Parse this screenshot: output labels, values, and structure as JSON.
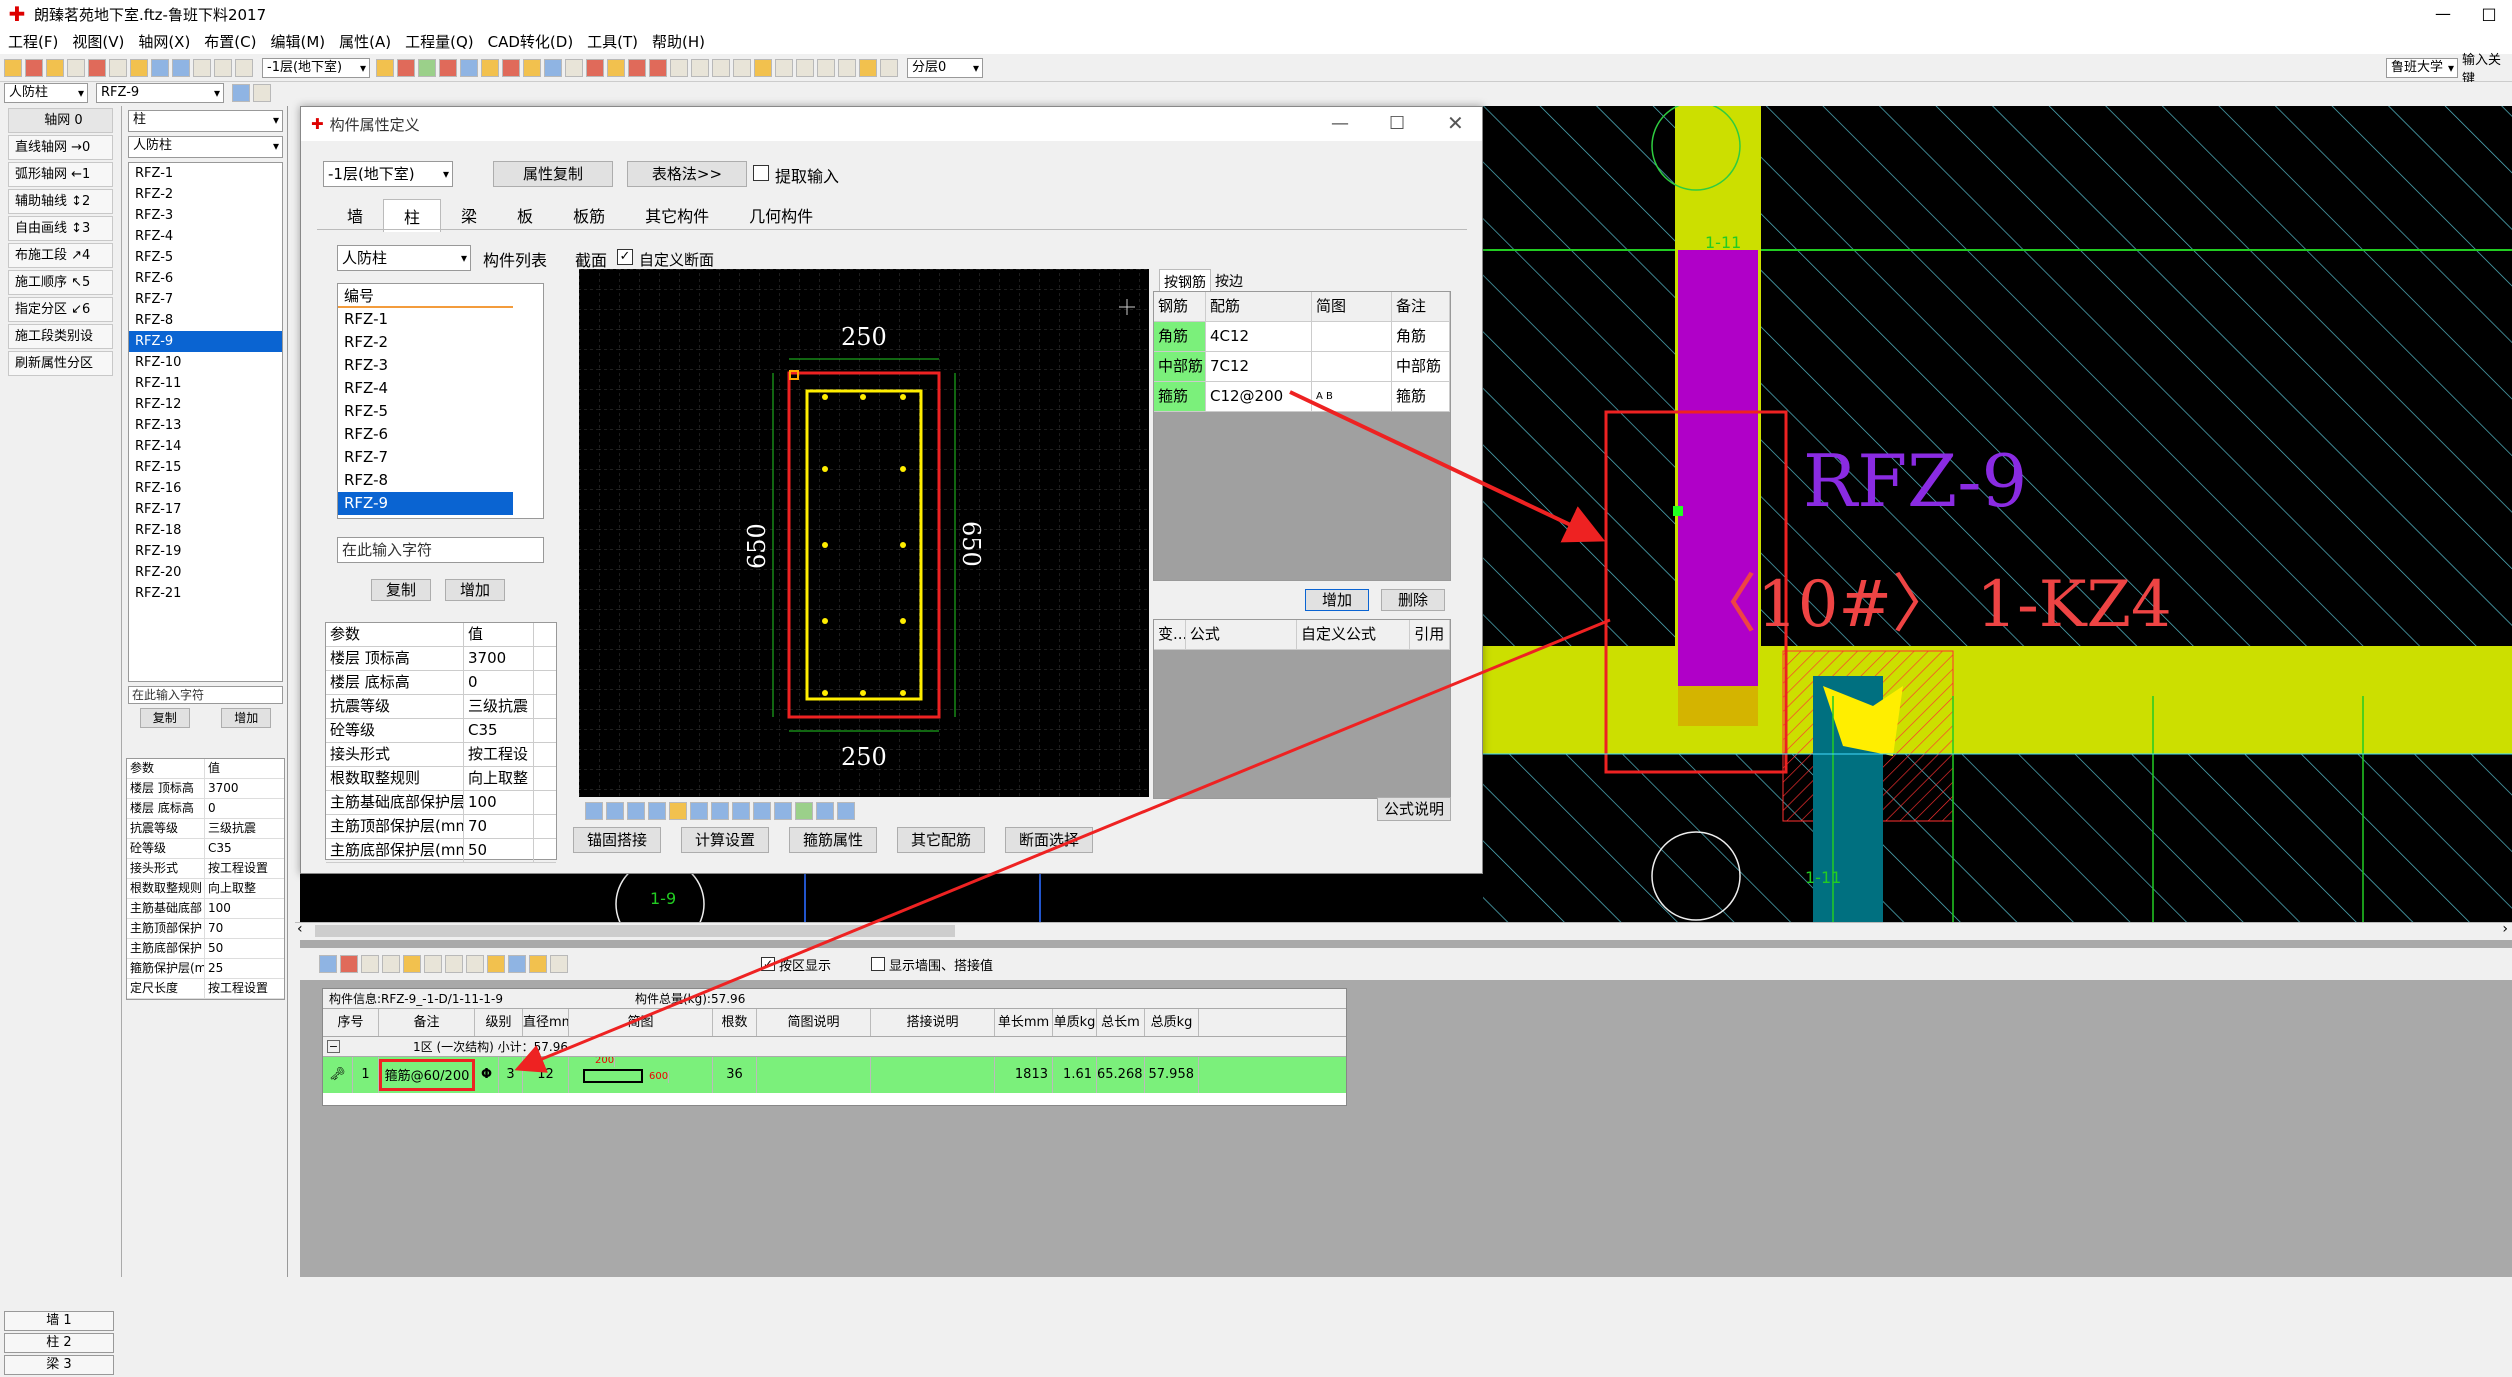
{
  "window": {
    "title": "朗臻茗苑地下室.ftz-鲁班下料2017",
    "controls": [
      "—",
      "□"
    ]
  },
  "menu": [
    "工程(F)",
    "视图(V)",
    "轴网(X)",
    "布置(C)",
    "编辑(M)",
    "属性(A)",
    "工程量(Q)",
    "CAD转化(D)",
    "工具(T)",
    "帮助(H)"
  ],
  "toolbar": {
    "floor_select": "-1层(地下室)",
    "layer_select": "分层0",
    "right_combo": "鲁班大学",
    "right_input": "输入关键"
  },
  "toolbar2": {
    "type_combo": "人防柱",
    "name_combo": "RFZ-9"
  },
  "left_nav": {
    "header": "轴网 0",
    "items": [
      "直线轴网 →0",
      "弧形轴网 ←1",
      "辅助轴线 ↕2",
      "自由画线 ↕3",
      "布施工段 ↗4",
      "施工顺序 ↖5",
      "指定分区 ↙6",
      "施工段类别设",
      "刷新属性分区"
    ],
    "bottom_tabs": [
      "墙 1",
      "柱 2",
      "梁 3"
    ]
  },
  "left_list": {
    "combo1": "柱",
    "combo2": "人防柱",
    "items": [
      "RFZ-1",
      "RFZ-2",
      "RFZ-3",
      "RFZ-4",
      "RFZ-5",
      "RFZ-6",
      "RFZ-7",
      "RFZ-8",
      "RFZ-9",
      "RFZ-10",
      "RFZ-11",
      "RFZ-12",
      "RFZ-13",
      "RFZ-14",
      "RFZ-15",
      "RFZ-16",
      "RFZ-17",
      "RFZ-18",
      "RFZ-19",
      "RFZ-20",
      "RFZ-21"
    ],
    "selected": "RFZ-9",
    "search_placeholder": "在此输入字符",
    "copy": "复制",
    "add": "增加",
    "param_header": [
      "参数",
      "值"
    ],
    "params": [
      [
        "楼层 顶标高",
        "3700"
      ],
      [
        "楼层 底标高",
        "0"
      ],
      [
        "抗震等级",
        "三级抗震"
      ],
      [
        "砼等级",
        "C35"
      ],
      [
        "接头形式",
        "按工程设置"
      ],
      [
        "根数取整规则",
        "向上取整"
      ],
      [
        "主筋基础底部",
        "100"
      ],
      [
        "主筋顶部保护",
        "70"
      ],
      [
        "主筋底部保护",
        "50"
      ],
      [
        "箍筋保护层(m",
        "25"
      ],
      [
        "定尺长度",
        "按工程设置"
      ]
    ]
  },
  "dialog": {
    "title": "构件属性定义",
    "floor": "-1层(地下室)",
    "btn_copy_attr": "属性复制",
    "btn_table": "表格法>>",
    "extract_label": "提取输入",
    "tabs": [
      "墙",
      "柱",
      "梁",
      "板",
      "板筋",
      "其它构件",
      "几何构件"
    ],
    "active_tab": "柱",
    "type_combo": "人防柱",
    "list_label": "构件列表",
    "list_header": "编号",
    "list_items": [
      "RFZ-1",
      "RFZ-2",
      "RFZ-3",
      "RFZ-4",
      "RFZ-5",
      "RFZ-6",
      "RFZ-7",
      "RFZ-8",
      "RFZ-9"
    ],
    "list_selected": "RFZ-9",
    "search_placeholder": "在此输入字符",
    "btn_copy": "复制",
    "btn_add": "增加",
    "section_label": "截面",
    "custom_section": "自定义断面",
    "dims": {
      "top": "250",
      "bottom": "250",
      "left": "650",
      "right": "650"
    },
    "param_header": [
      "参数",
      "值"
    ],
    "params": [
      [
        "楼层 顶标高",
        "3700"
      ],
      [
        "楼层 底标高",
        "0"
      ],
      [
        "抗震等级",
        "三级抗震"
      ],
      [
        "砼等级",
        "C35"
      ],
      [
        "接头形式",
        "按工程设"
      ],
      [
        "根数取整规则",
        "向上取整"
      ],
      [
        "主筋基础底部保护层(",
        "100"
      ],
      [
        "主筋顶部保护层(mm",
        "70"
      ],
      [
        "主筋底部保护层(mm",
        "50"
      ]
    ],
    "rebar_tabs": [
      "按钢筋",
      "按边"
    ],
    "rebar_header": [
      "钢筋",
      "配筋",
      "简图",
      "备注"
    ],
    "rebar_rows": [
      [
        "角筋",
        "4C12",
        "",
        "角筋"
      ],
      [
        "中部筋",
        "7C12",
        "",
        "中部筋"
      ],
      [
        "箍筋",
        "C12@200",
        "A B",
        "箍筋"
      ]
    ],
    "btn_add2": "增加",
    "btn_delete": "删除",
    "formula_header": [
      "变...",
      "公式",
      "自定义公式",
      "引用"
    ],
    "formula_help": "公式说明",
    "bottom_buttons": [
      "锚固搭接",
      "计算设置",
      "箍筋属性",
      "其它配筋",
      "断面选择"
    ]
  },
  "cad": {
    "label1": "RFZ-9",
    "label2": "〈10#〉 1-KZ4",
    "axis_labels": [
      "1-11",
      "1-11",
      "1-9"
    ]
  },
  "bottom": {
    "check1": "按区显示",
    "check2": "显示墙围、搭接值",
    "info_left": "构件信息:RFZ-9_-1-D/1-11-1-9",
    "info_right": "构件总量(kg):57.96",
    "headers": [
      "序号",
      "备注",
      "级别",
      "直径mm",
      "简图",
      "根数",
      "简图说明",
      "搭接说明",
      "单长mm",
      "单质kg",
      "总长m",
      "总质kg"
    ],
    "group_row": "1区 (一次结构) 小计：57.96",
    "row": {
      "index": "1",
      "note": "箍筋@60/200",
      "grade": "Φ",
      "level": "3",
      "dia": "12",
      "dim_a": "200",
      "dim_b": "600",
      "count": "36",
      "single_len": "1813",
      "single_kg": "1.61",
      "total_len": "65.268",
      "total_kg": "57.958"
    }
  },
  "colors": {
    "accent_blue": "#0a64d2",
    "highlight_green": "#7bf07b",
    "annot_red": "#ee2222",
    "cad_yellow": "#ccdf00",
    "cad_magenta": "#b000c8"
  }
}
